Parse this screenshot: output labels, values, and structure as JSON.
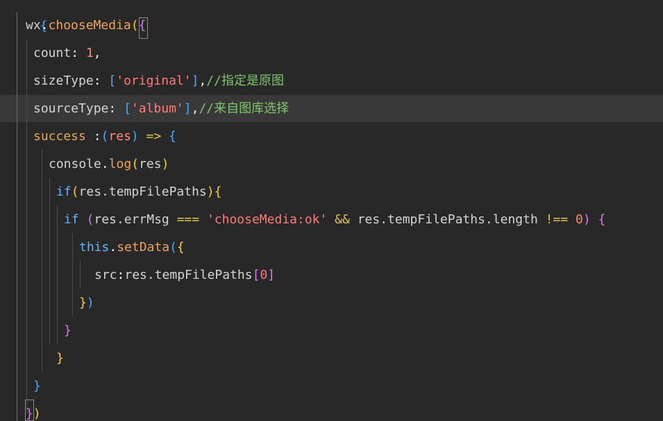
{
  "editor": {
    "language": "javascript",
    "lines": {
      "l0": {
        "brace": "{"
      },
      "l1": {
        "obj": "wx",
        "dot": ".",
        "fn": "chooseMedia",
        "open": "(",
        "brace": "{"
      },
      "l2": {
        "key": "count",
        "colon": ": ",
        "val": "1",
        "comma": ","
      },
      "l3": {
        "key": "sizeType",
        "colon": ": ",
        "ob": "[",
        "str": "'original'",
        "cb": "]",
        "comma": ",",
        "comment": "//指定是原图"
      },
      "l4": {
        "key": "sourceType",
        "colon": ": ",
        "ob": "[",
        "str": "'album'",
        "cb": "]",
        "comma": ",",
        "comment": "//来自图库选择"
      },
      "l5": {
        "key": "success",
        "colon": " :",
        "op": "(",
        "param": "res",
        "cp": ")",
        "arrow": " => ",
        "brace": "{"
      },
      "l6": {
        "obj": "console",
        "dot": ".",
        "fn": "log",
        "op": "(",
        "arg": "res",
        "cp": ")"
      },
      "l7": {
        "kw": "if",
        "op": "(",
        "expr": "res.tempFilePaths",
        "cp": ")",
        "brace": "{"
      },
      "l8": {
        "kw": "if",
        "op": " (",
        "expr1": "res.errMsg ",
        "eq": "===",
        "str": " 'chooseMedia:ok'",
        "and": " && ",
        "expr2": "res.tempFilePaths.length ",
        "neq": "!==",
        "zero": " 0",
        "cp": ")",
        "brace": " {"
      },
      "l9": {
        "kw": "this",
        "dot": ".",
        "fn": "setData",
        "op": "(",
        "brace": "{"
      },
      "l10": {
        "key": "src",
        "colon": ":",
        "expr": "res.tempFilePaths",
        "ob": "[",
        "idx": "0",
        "cb": "]"
      },
      "l11": {
        "brace": "}",
        "cp": ")"
      },
      "l12": {
        "brace": "}"
      },
      "l13": {
        "brace": "}"
      },
      "l14": {
        "brace": "}"
      },
      "l15": {
        "brace": "}",
        "cp": ")"
      }
    }
  },
  "colors": {
    "background": "#282828",
    "current_line": "#393939",
    "function": "#f0a35a",
    "string": "#ff7a7a",
    "comment": "#7fc66b",
    "keyword": "#61b3ff",
    "bracket_gold": "#f7d03c",
    "bracket_purple": "#d67ae8",
    "bracket_blue": "#4aa8ff"
  }
}
